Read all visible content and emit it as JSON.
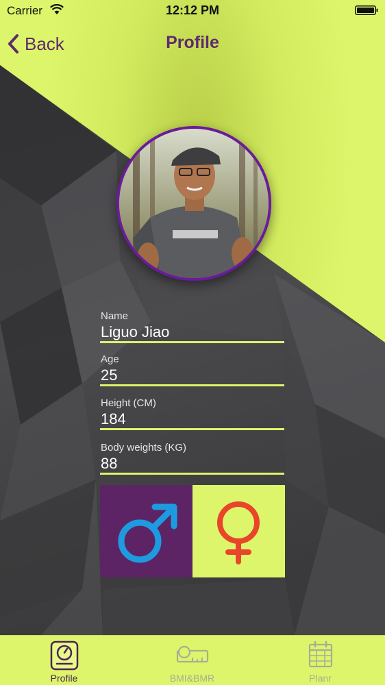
{
  "status_bar": {
    "carrier": "Carrier",
    "time": "12:12 PM"
  },
  "nav": {
    "back_label": "Back",
    "title": "Profile"
  },
  "profile": {
    "fields": [
      {
        "label": "Name",
        "value": "Liguo Jiao"
      },
      {
        "label": "Age",
        "value": "25"
      },
      {
        "label": "Height (CM)",
        "value": "184"
      },
      {
        "label": "Body weights (KG)",
        "value": "88"
      }
    ],
    "gender": {
      "male_icon": "male-symbol-icon",
      "female_icon": "female-symbol-icon"
    }
  },
  "tabs": [
    {
      "label": "Profile",
      "icon": "scale-icon",
      "active": true
    },
    {
      "label": "BMI&BMR",
      "icon": "measuring-tape-icon",
      "active": false
    },
    {
      "label": "Planr",
      "icon": "calendar-icon",
      "active": false
    }
  ],
  "colors": {
    "accent_lime": "#dcf56a",
    "brand_purple": "#5e2b6e",
    "avatar_ring": "#6a1b9a",
    "male_blue": "#1e9be0",
    "female_red": "#e8452b"
  }
}
